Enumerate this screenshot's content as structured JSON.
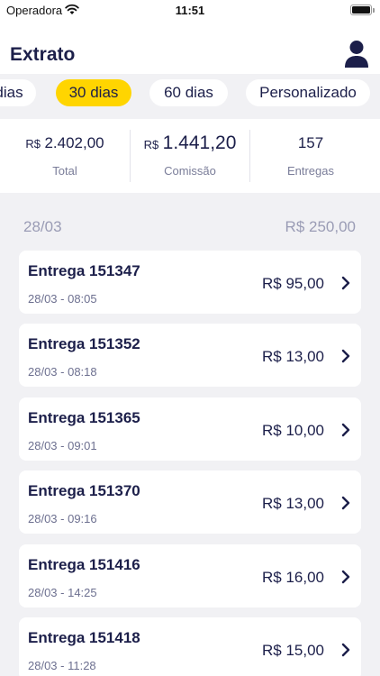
{
  "status_bar": {
    "carrier": "Operadora",
    "time": "11:51"
  },
  "header": {
    "title": "Extrato"
  },
  "filters": [
    {
      "label": "dias",
      "active": false
    },
    {
      "label": "30 dias",
      "active": true
    },
    {
      "label": "60 dias",
      "active": false
    },
    {
      "label": "Personalizado",
      "active": false
    }
  ],
  "summary": {
    "total": {
      "currency": "R$",
      "value": "2.402,00",
      "label": "Total"
    },
    "comissao": {
      "currency": "R$",
      "value": "1.441,20",
      "label": "Comissão"
    },
    "entregas": {
      "value": "157",
      "label": "Entregas"
    }
  },
  "day": {
    "date": "28/03",
    "total": "R$ 250,00"
  },
  "deliveries": [
    {
      "title": "Entrega 151347",
      "datetime": "28/03 - 08:05",
      "amount": "R$ 95,00"
    },
    {
      "title": "Entrega 151352",
      "datetime": "28/03 - 08:18",
      "amount": "R$ 13,00"
    },
    {
      "title": "Entrega 151365",
      "datetime": "28/03 - 09:01",
      "amount": "R$ 10,00"
    },
    {
      "title": "Entrega 151370",
      "datetime": "28/03 - 09:16",
      "amount": "R$ 13,00"
    },
    {
      "title": "Entrega 151416",
      "datetime": "28/03 - 14:25",
      "amount": "R$ 16,00"
    },
    {
      "title": "Entrega 151418",
      "datetime": "28/03 - 11:28",
      "amount": "R$ 15,00"
    }
  ],
  "colors": {
    "accent": "#ffd500",
    "navy": "#1c1f4a",
    "background": "#f1f1f4",
    "muted": "#9a9cb5"
  },
  "icons": {
    "profile": "person-icon",
    "row_action": "chevron-right-icon",
    "wifi": "wifi-icon",
    "battery": "battery-icon"
  }
}
